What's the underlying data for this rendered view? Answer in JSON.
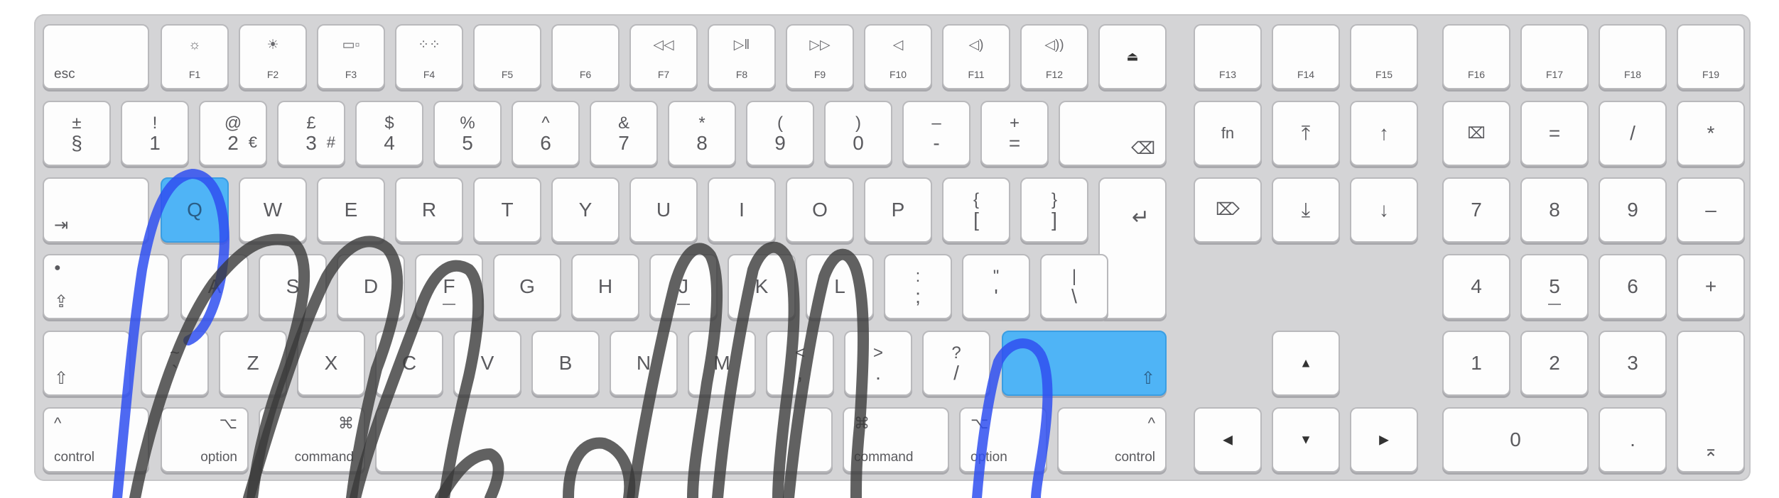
{
  "colors": {
    "highlight": "#4fb4f6",
    "finger_stroke": "#3a3a3a",
    "pinky_stroke": "#2f4ff0"
  },
  "keys": {
    "esc": "esc",
    "f1": "F1",
    "f2": "F2",
    "f3": "F3",
    "f4": "F4",
    "f5": "F5",
    "f6": "F6",
    "f7": "F7",
    "f8": "F8",
    "f9": "F9",
    "f10": "F10",
    "f11": "F11",
    "f12": "F12",
    "f13": "F13",
    "f14": "F14",
    "f15": "F15",
    "f16": "F16",
    "f17": "F17",
    "f18": "F18",
    "f19": "F19",
    "sect_top": "±",
    "sect_bot": "§",
    "k1_top": "!",
    "k1_bot": "1",
    "k2_top": "@",
    "k2_bot": "2",
    "k2_extra": "€",
    "k3_top": "£",
    "k3_bot": "3",
    "k3_extra": "#",
    "k4_top": "$",
    "k4_bot": "4",
    "k5_top": "%",
    "k5_bot": "5",
    "k6_top": "^",
    "k6_bot": "6",
    "k7_top": "&",
    "k7_bot": "7",
    "k8_top": "*",
    "k8_bot": "8",
    "k9_top": "(",
    "k9_bot": "9",
    "k0_top": ")",
    "k0_bot": "0",
    "minus_top": "–",
    "minus_bot": "-",
    "equal_top": "+",
    "equal_bot": "=",
    "fn": "fn",
    "q": "Q",
    "w": "W",
    "e": "E",
    "r": "R",
    "t": "T",
    "y": "Y",
    "u": "U",
    "i": "I",
    "o": "O",
    "p": "P",
    "lbrace_top": "{",
    "lbrace_bot": "[",
    "rbrace_top": "}",
    "rbrace_bot": "]",
    "a": "A",
    "s": "S",
    "d": "D",
    "f": "F",
    "g": "G",
    "h": "H",
    "j": "J",
    "k": "K",
    "l": "L",
    "semi_top": ":",
    "semi_bot": ";",
    "quote_top": "\"",
    "quote_bot": "'",
    "pipe_top": "|",
    "pipe_bot": "\\",
    "tilde_top": "~",
    "tilde_bot": "`",
    "z": "Z",
    "x": "X",
    "c": "C",
    "v": "V",
    "b": "B",
    "n": "N",
    "m": "M",
    "comma_top": "<",
    "comma_bot": ",",
    "period_top": ">",
    "period_bot": ".",
    "slash_top": "?",
    "slash_bot": "/",
    "control": "control",
    "option": "option",
    "command": "command",
    "np_equal": "=",
    "np_slash": "/",
    "np_star": "*",
    "np_minus": "–",
    "np_plus": "+",
    "np_dot": ".",
    "np7": "7",
    "np8": "8",
    "np9": "9",
    "np4": "4",
    "np5": "5",
    "np6": "6",
    "np1": "1",
    "np2": "2",
    "np3": "3",
    "np0": "0"
  },
  "icons": {
    "f1": "brightness-down-icon",
    "f2": "brightness-up-icon",
    "f3": "mission-control-icon",
    "f4": "launchpad-icon",
    "f7": "rewind-icon",
    "f8": "play-pause-icon",
    "f9": "fast-forward-icon",
    "f10": "mute-icon",
    "f11": "volume-down-icon",
    "f12": "volume-up-icon",
    "eject": "eject-icon",
    "delete": "delete-icon",
    "tab": "tab-icon",
    "return": "return-icon",
    "caps": "caps-lock-icon",
    "shift": "shift-icon"
  }
}
